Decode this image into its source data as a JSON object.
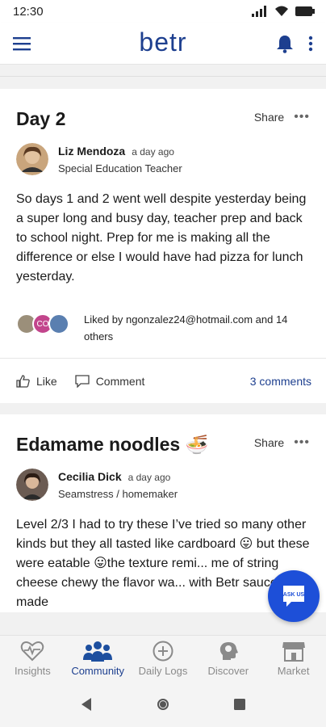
{
  "status_bar": {
    "time": "12:30"
  },
  "app_bar": {
    "logo": "betr"
  },
  "posts": [
    {
      "title": "Day 2",
      "share_label": "Share",
      "author_name": "Liz Mendoza",
      "time": "a day ago",
      "role": "Special Education Teacher",
      "body": "So days 1 and 2 went well despite yesterday being a super long and busy day, teacher prep and back to school night. Prep for me is making all the difference or else I would have had pizza for lunch yesterday.",
      "avatar_initials": [
        "CO"
      ],
      "liked_text": "Liked by ngonzalez24@hotmail.com and 14 others",
      "like_label": "Like",
      "comment_label": "Comment",
      "comments_count": "3 comments"
    },
    {
      "title": "Edamame noodles 🍜",
      "share_label": "Share",
      "author_name": "Cecilia Dick",
      "time": "a day ago",
      "role": "Seamstress / homemaker",
      "body": "Level 2/3 I had to try these I’ve tried so many other kinds but they all tasted like cardboard 😛 but these were eatable 😛the texture remi... me of string cheese chewy the flavor wa... with Betr sauce I made"
    }
  ],
  "fab": {
    "label": "ASK US"
  },
  "bottom_nav": [
    {
      "label": "Insights",
      "icon": "heart-pulse-icon",
      "active": false
    },
    {
      "label": "Community",
      "icon": "people-icon",
      "active": true
    },
    {
      "label": "Daily Logs",
      "icon": "plus-circle-icon",
      "active": false
    },
    {
      "label": "Discover",
      "icon": "head-icon",
      "active": false
    },
    {
      "label": "Market",
      "icon": "storefront-icon",
      "active": false
    }
  ],
  "colors": {
    "brand": "#1d3f8f",
    "fab": "#1d4fd8",
    "inactive": "#8a8a8a"
  }
}
